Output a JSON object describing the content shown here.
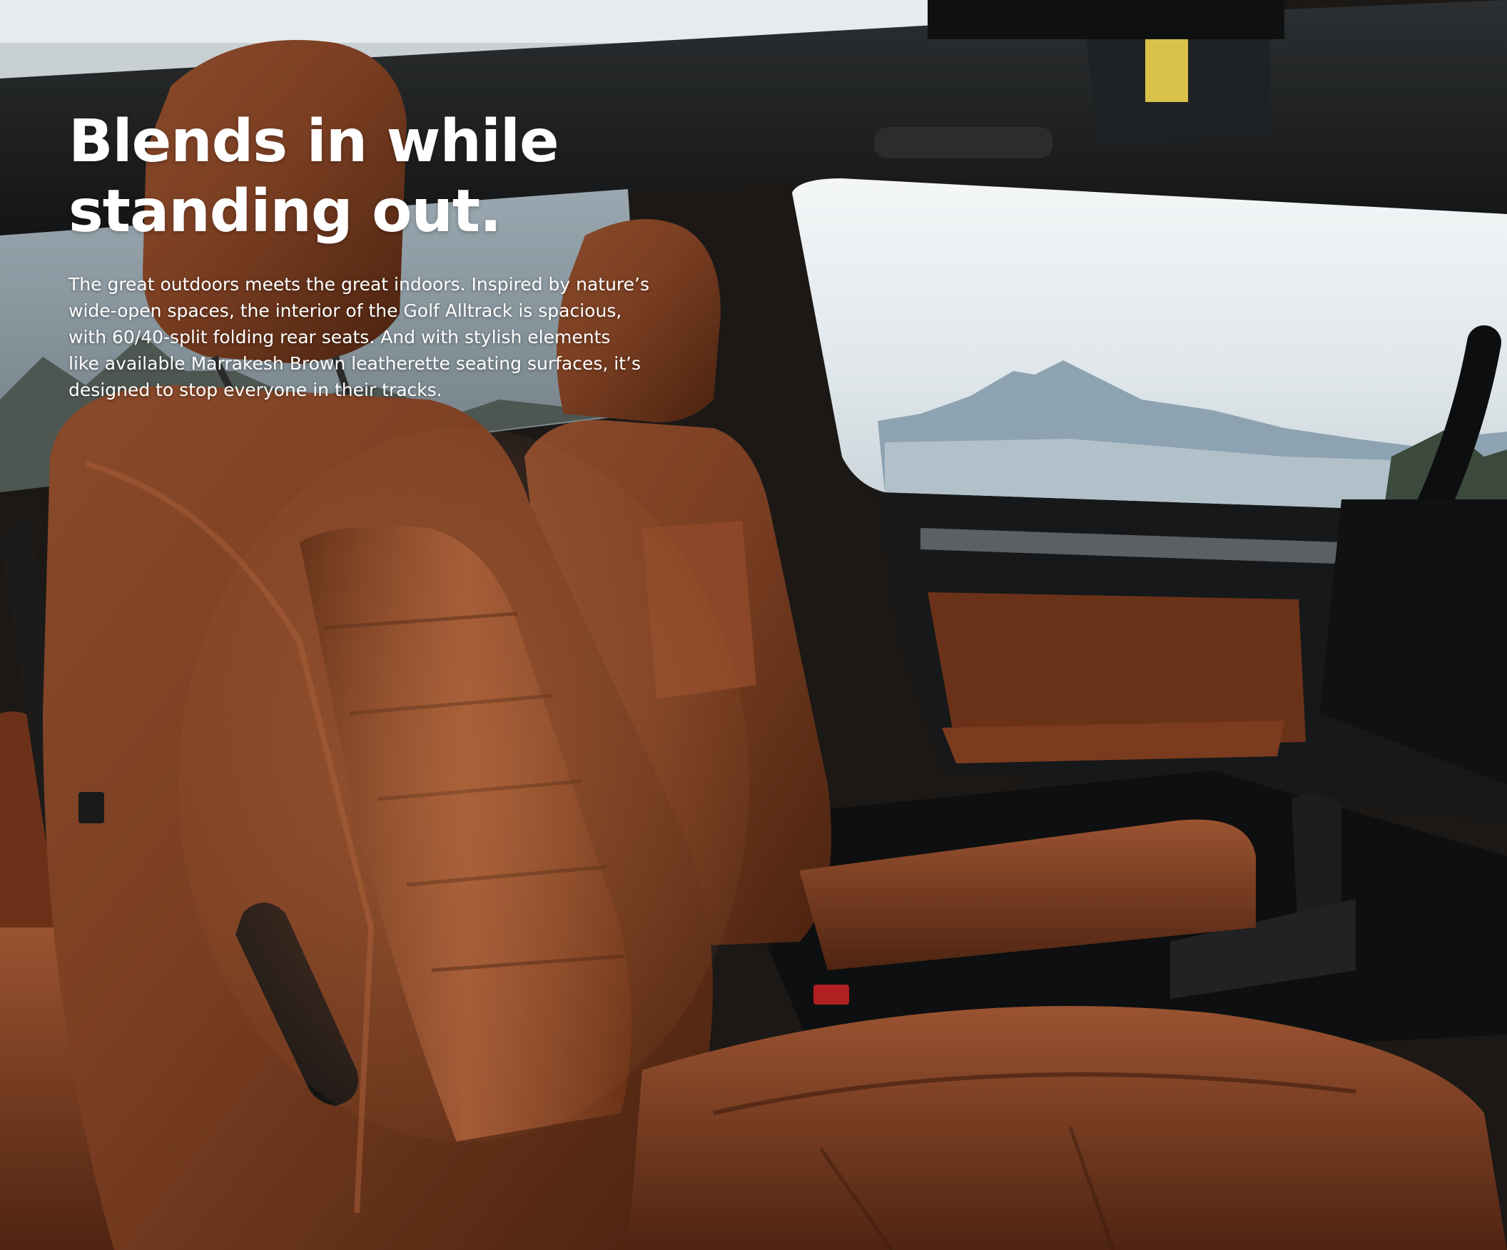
{
  "page": {
    "headline_lines": [
      "Blends in while",
      "standing out."
    ],
    "body_lines": [
      "The great outdoors meets the great indoors. Inspired by nature’s",
      "wide-open spaces, the interior of the Golf Alltrack is spacious,",
      "with 60/40-split folding rear seats. And with stylish elements",
      "like available Marrakesh Brown leatherette seating surfaces, it’s",
      "designed to stop everyone in their tracks."
    ]
  },
  "photo": {
    "subject": "vehicle interior with brown leatherette seats",
    "colors": {
      "leather": "#7a3e22",
      "leather_highlight": "#a35a35",
      "leather_shadow": "#3e1c0e",
      "dark_trim": "#161616",
      "sky": "#dfe6ea",
      "mountain": "#8ea3b1"
    }
  }
}
